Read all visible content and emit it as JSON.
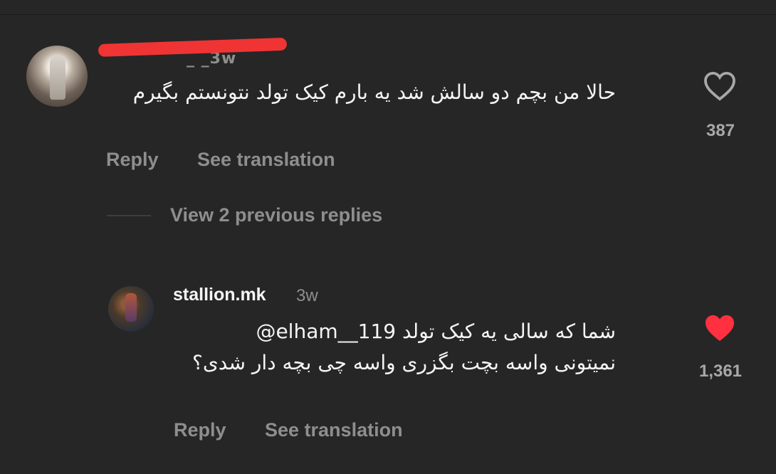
{
  "comments": [
    {
      "username_visible": "_ _3w",
      "text": "حالا من بچم دو سالش شد یه بارم کیک تولد نتونستم بگیرم",
      "likes": "387",
      "liked": false,
      "reply_label": "Reply",
      "translate_label": "See translation"
    }
  ],
  "thread": {
    "view_previous_label": "View 2 previous replies"
  },
  "reply": {
    "username": "stallion.mk",
    "time": "3w",
    "mention": "@elham__119",
    "text_line1": "شما که سالی یه کیک تولد",
    "text_rest": "نمیتونی واسه بچت بگزری واسه چی بچه دار شدی؟",
    "likes": "1,361",
    "liked": true,
    "reply_label": "Reply",
    "translate_label": "See translation"
  },
  "colors": {
    "background": "#262626",
    "heart_liked": "#ff3040",
    "redaction": "#f03434"
  }
}
